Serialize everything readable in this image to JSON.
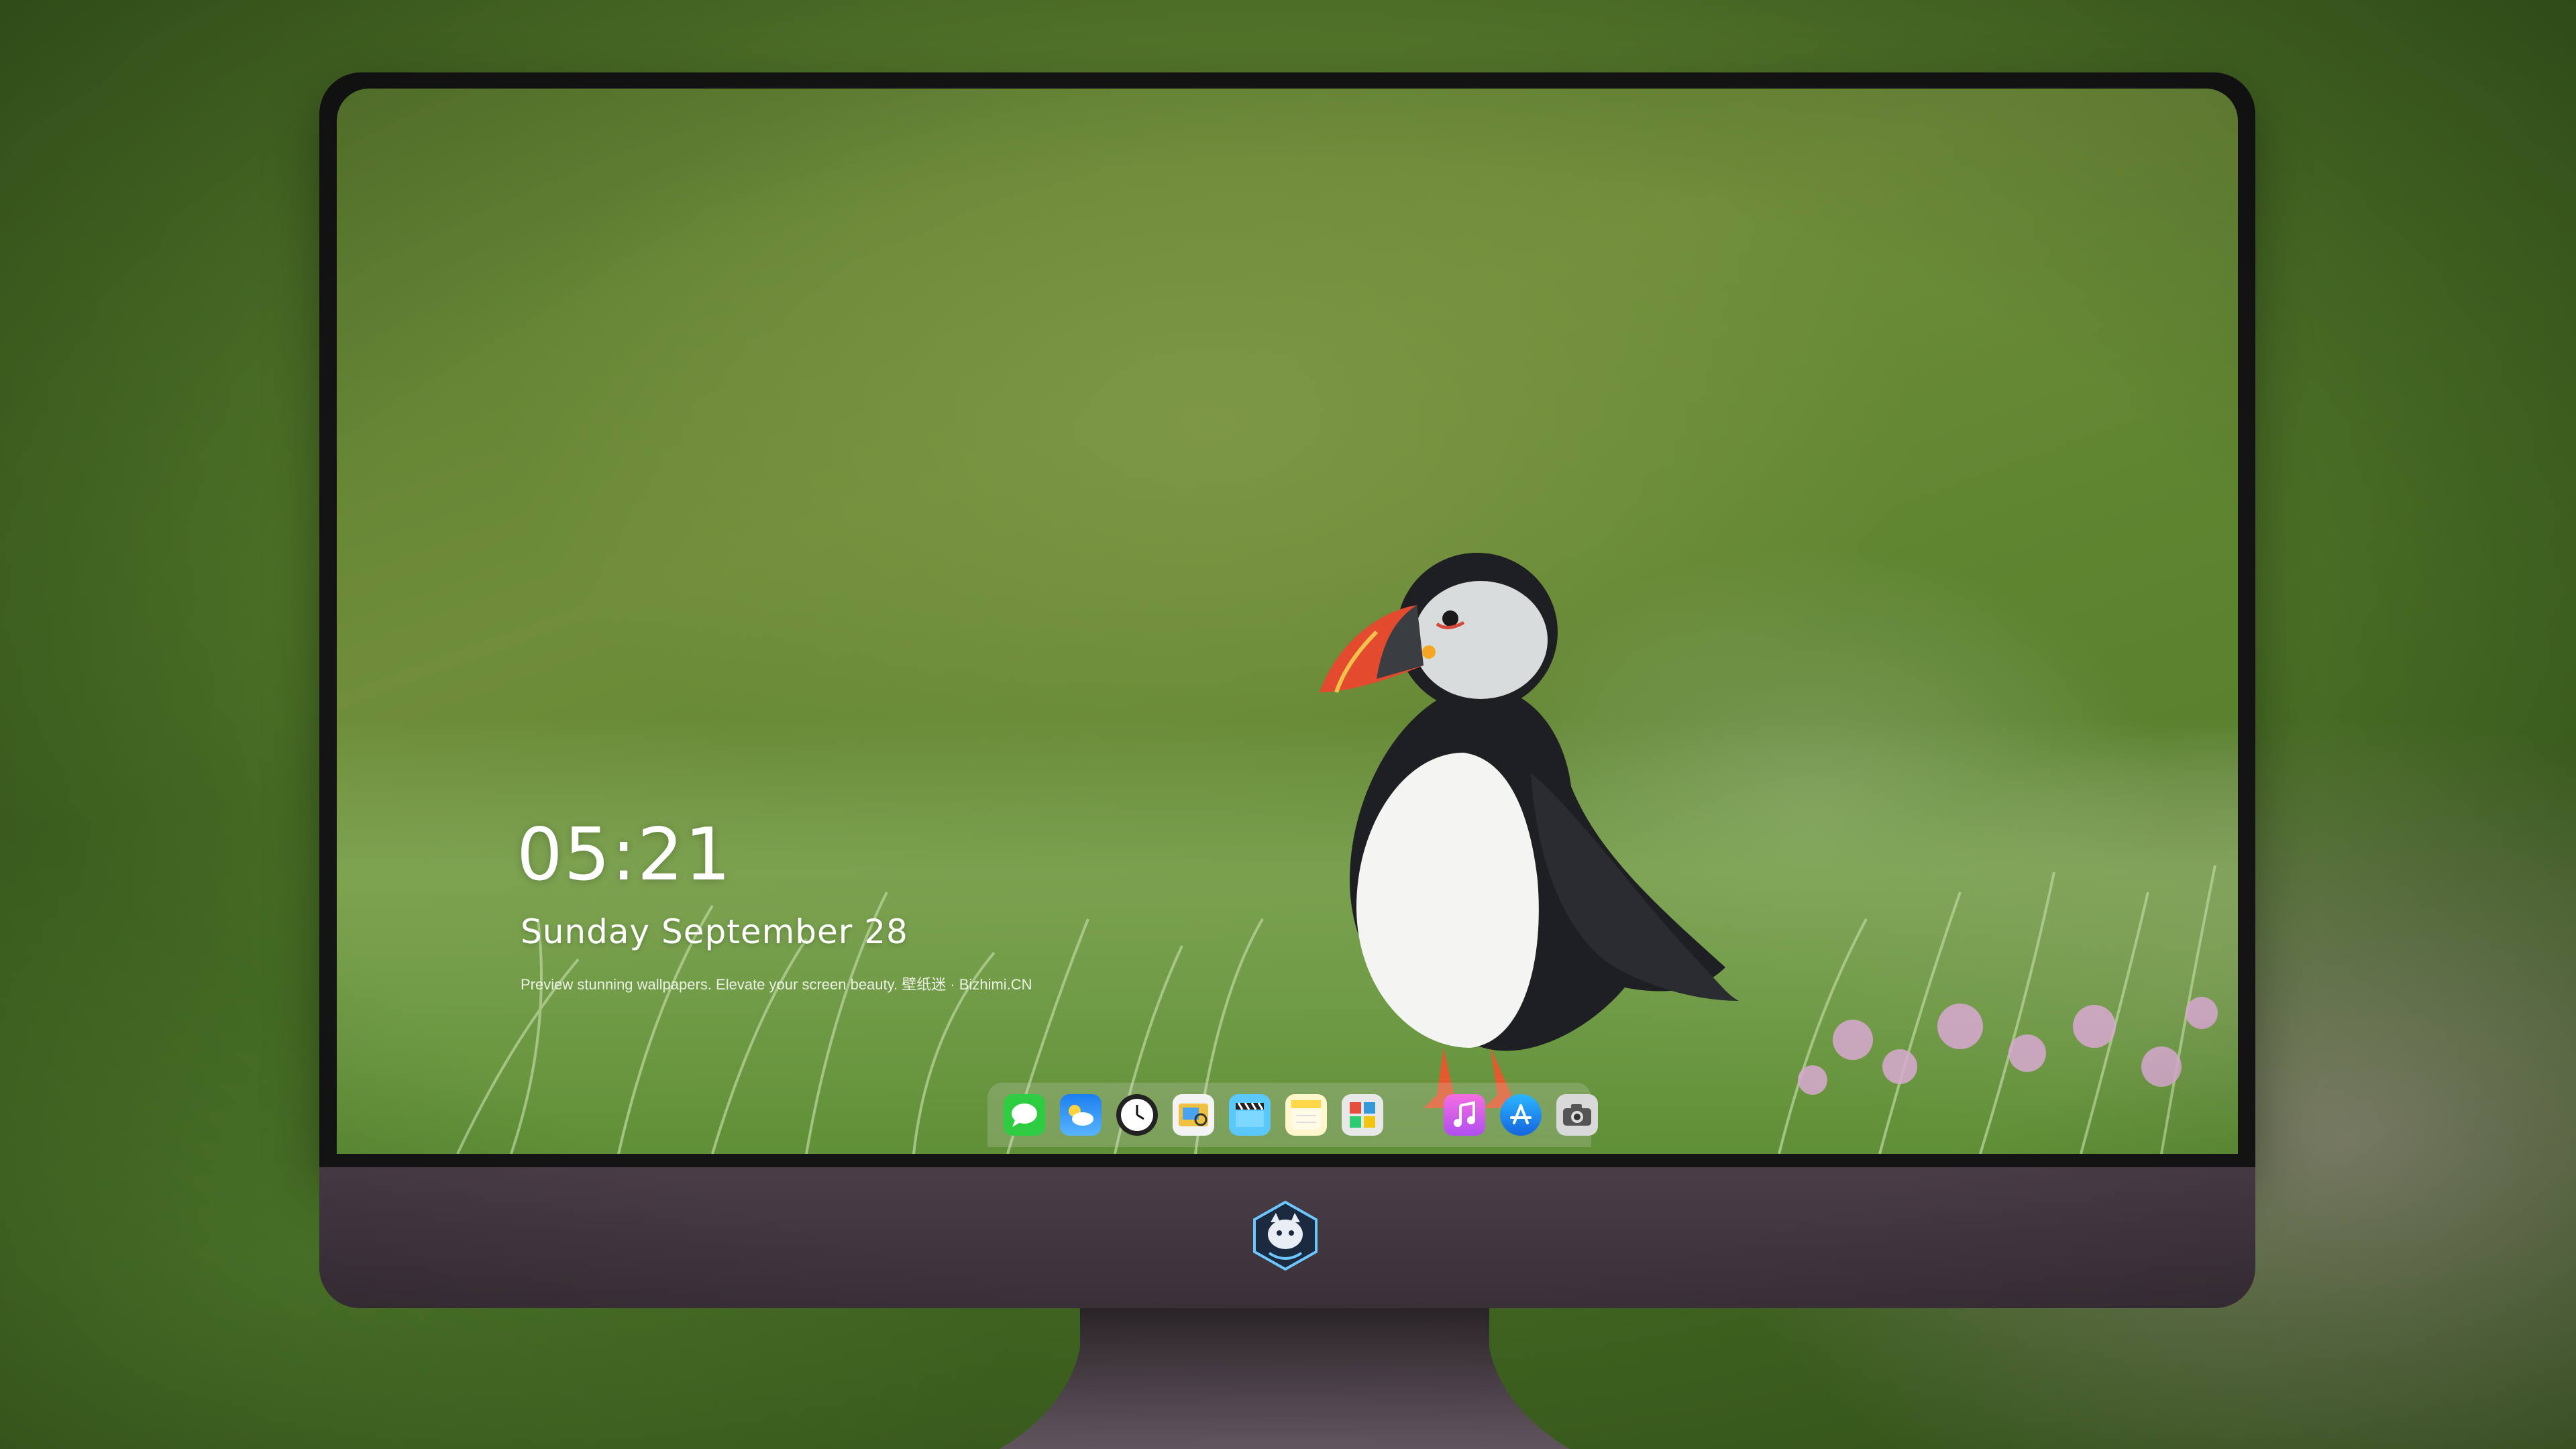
{
  "lockscreen": {
    "time": "05:21",
    "date": "Sunday September  28",
    "tagline": "Preview stunning wallpapers. Elevate your screen beauty. 壁纸迷 · Bizhimi.CN"
  },
  "dock": {
    "items": [
      {
        "name": "messages",
        "color": "#2ecc40"
      },
      {
        "name": "weather",
        "color": "#2a8ef0"
      },
      {
        "name": "clock",
        "color": "#ffffff"
      },
      {
        "name": "preview",
        "color": "#f0c040"
      },
      {
        "name": "clips",
        "color": "#5ac8fa"
      },
      {
        "name": "notes",
        "color": "#ffd84a"
      },
      {
        "name": "photo-booth",
        "color": "#e8e8e8"
      },
      {
        "name": "music",
        "color": "#ee5fe0"
      },
      {
        "name": "app-store",
        "color": "#1e90ff"
      },
      {
        "name": "camera",
        "color": "#6a6a6a"
      }
    ]
  },
  "colors": {
    "bezel": "#141414",
    "chin": "#433740",
    "stand": "#3a3036"
  }
}
